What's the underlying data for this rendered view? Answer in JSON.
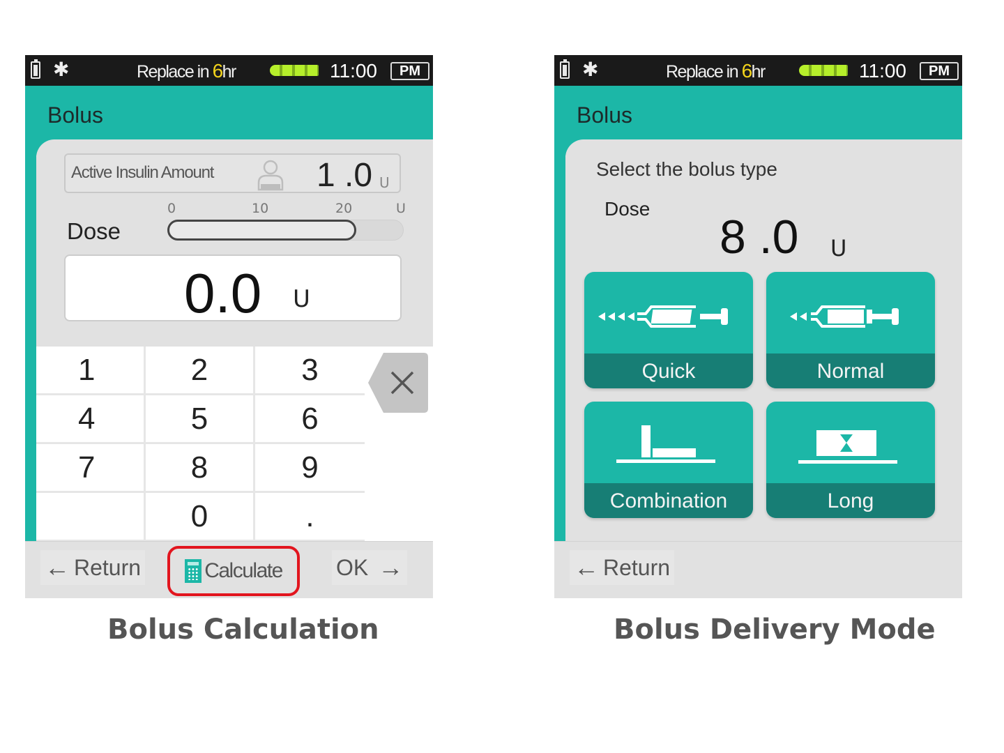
{
  "status_bar": {
    "replace_prefix": "Replace in ",
    "replace_hours": "6",
    "replace_suffix": "hr",
    "reservoir_level_percent": 100,
    "time": "11:00",
    "ampm": "PM",
    "bluetooth_glyph": "✱"
  },
  "colors": {
    "teal": "#1cb7a7",
    "teal_dark": "#177e75",
    "highlight_red": "#e2151e",
    "replace_hours_yellow": "#f2d31b",
    "reservoir_green": "#b6ef2b"
  },
  "left_screen": {
    "title": "Bolus",
    "active_insulin": {
      "label": "Active Insulin Amount",
      "value": "1 .0",
      "unit": "U"
    },
    "dose_scale": {
      "ticks": [
        "0",
        "10",
        "20",
        "U"
      ],
      "max_units": 25,
      "fill_units": 20
    },
    "dose_label": "Dose",
    "dose_value": "0.0",
    "dose_unit": "U",
    "keypad": [
      [
        "1",
        "2",
        "3"
      ],
      [
        "4",
        "5",
        "6"
      ],
      [
        "7",
        "8",
        "9"
      ],
      [
        "",
        "0",
        "."
      ]
    ],
    "backspace_glyph": "✕",
    "buttons": {
      "return_arrow": "←",
      "return_label": "Return",
      "calculate_label": "Calculate",
      "ok_label": "OK",
      "ok_arrow": "→"
    },
    "caption": "Bolus Calculation"
  },
  "right_screen": {
    "title": "Bolus",
    "select_title": "Select the bolus type",
    "dose_label": "Dose",
    "dose_value": "8 .0",
    "dose_unit": "U",
    "modes": [
      {
        "label": "Quick",
        "icon": "syringe-fast-icon"
      },
      {
        "label": "Normal",
        "icon": "syringe-icon"
      },
      {
        "label": "Combination",
        "icon": "combination-icon"
      },
      {
        "label": "Long",
        "icon": "hourglass-icon"
      }
    ],
    "buttons": {
      "return_arrow": "←",
      "return_label": "Return"
    },
    "caption": "Bolus Delivery Mode"
  }
}
